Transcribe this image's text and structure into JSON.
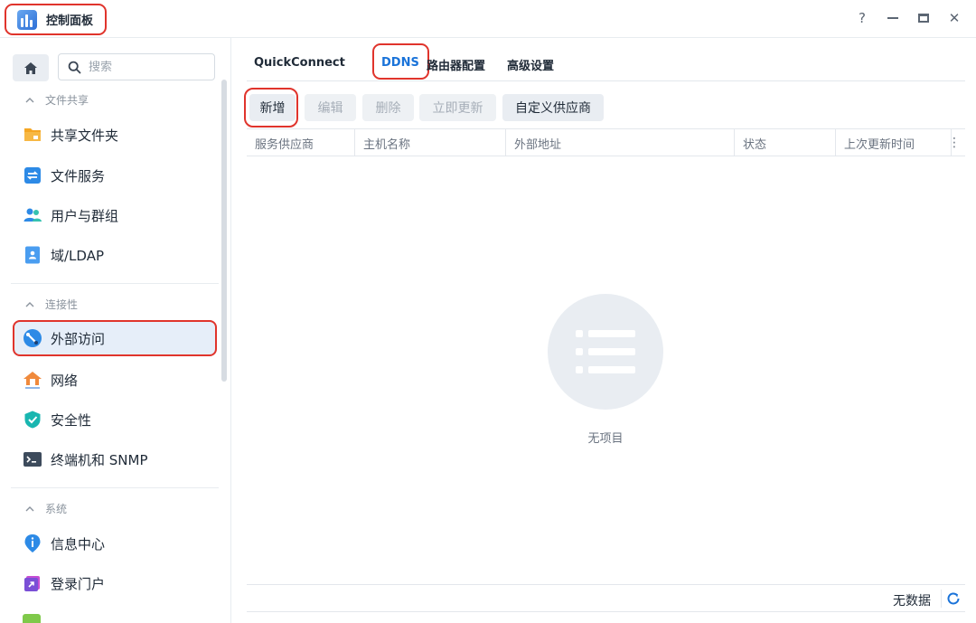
{
  "window": {
    "title": "控制面板",
    "help_label": "?",
    "close_label": "✕"
  },
  "sidebar": {
    "search_placeholder": "搜索",
    "sections": [
      {
        "label": "文件共享"
      },
      {
        "label": "连接性"
      },
      {
        "label": "系统"
      }
    ],
    "items": [
      {
        "label": "共享文件夹",
        "icon": "shared-folder-icon"
      },
      {
        "label": "文件服务",
        "icon": "file-services-icon"
      },
      {
        "label": "用户与群组",
        "icon": "users-groups-icon"
      },
      {
        "label": "域/LDAP",
        "icon": "domain-ldap-icon"
      },
      {
        "label": "外部访问",
        "icon": "external-access-icon",
        "active": true
      },
      {
        "label": "网络",
        "icon": "network-icon"
      },
      {
        "label": "安全性",
        "icon": "security-shield-icon"
      },
      {
        "label": "终端机和 SNMP",
        "icon": "terminal-icon"
      },
      {
        "label": "信息中心",
        "icon": "info-center-icon"
      },
      {
        "label": "登录门户",
        "icon": "login-portal-icon"
      }
    ]
  },
  "tabs": [
    {
      "label": "QuickConnect"
    },
    {
      "label": "DDNS",
      "active": true
    },
    {
      "label": "路由器配置"
    },
    {
      "label": "高级设置"
    }
  ],
  "toolbar": {
    "add": "新增",
    "edit": "编辑",
    "delete": "删除",
    "update_now": "立即更新",
    "custom_provider": "自定义供应商"
  },
  "table": {
    "columns": [
      "服务供应商",
      "主机名称",
      "外部地址",
      "状态",
      "上次更新时间"
    ],
    "menu_label": "⋮",
    "rows": [],
    "empty_text": "无项目"
  },
  "footer": {
    "status": "无数据"
  },
  "colors": {
    "accent": "#1a73d9",
    "highlight": "#e0342c"
  }
}
